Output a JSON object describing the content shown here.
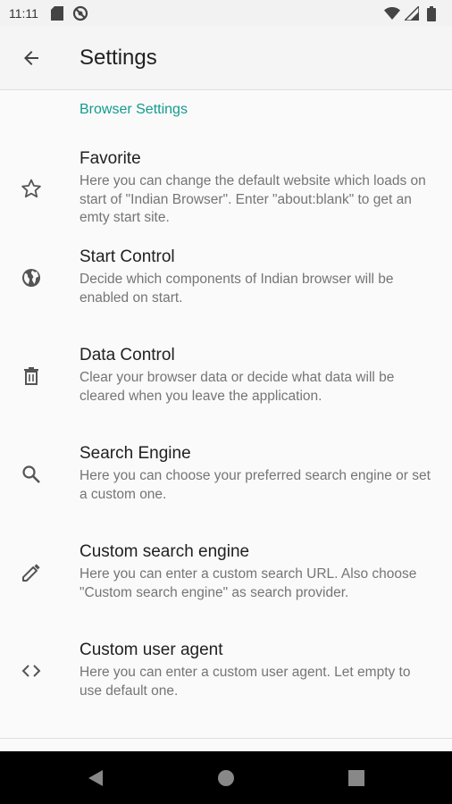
{
  "status_bar": {
    "time": "11:11",
    "icons": [
      "sd-card-icon",
      "blocked-circle-icon",
      "wifi-icon",
      "signal-icon",
      "battery-icon"
    ]
  },
  "app_bar": {
    "title": "Settings",
    "back_icon": "arrow-back-icon"
  },
  "section": {
    "title": "Browser Settings",
    "accent_color": "#129b8e"
  },
  "items": [
    {
      "icon": "star-icon",
      "title": "Favorite",
      "summary": "Here you can change the default website which loads on start of \"Indian Browser\". Enter \"about:blank\" to get an emty start site."
    },
    {
      "icon": "globe-icon",
      "title": "Start Control",
      "summary": "Decide which components of Indian browser will be enabled on start."
    },
    {
      "icon": "trash-icon",
      "title": "Data Control",
      "summary": "Clear your browser data or decide what data will be cleared when you leave the application."
    },
    {
      "icon": "search-icon",
      "title": "Search Engine",
      "summary": "Here you can choose your preferred search engine or set a custom one."
    },
    {
      "icon": "pencil-icon",
      "title": "Custom search engine",
      "summary": "Here you can enter a custom search URL. Also choose \"Custom search engine\" as search provider."
    },
    {
      "icon": "code-icon",
      "title": "Custom user agent",
      "summary": "Here you can enter a custom user agent. Let empty to use default one."
    }
  ],
  "nav_bar": {
    "buttons": [
      "back-triangle-icon",
      "home-circle-icon",
      "recents-square-icon"
    ]
  }
}
